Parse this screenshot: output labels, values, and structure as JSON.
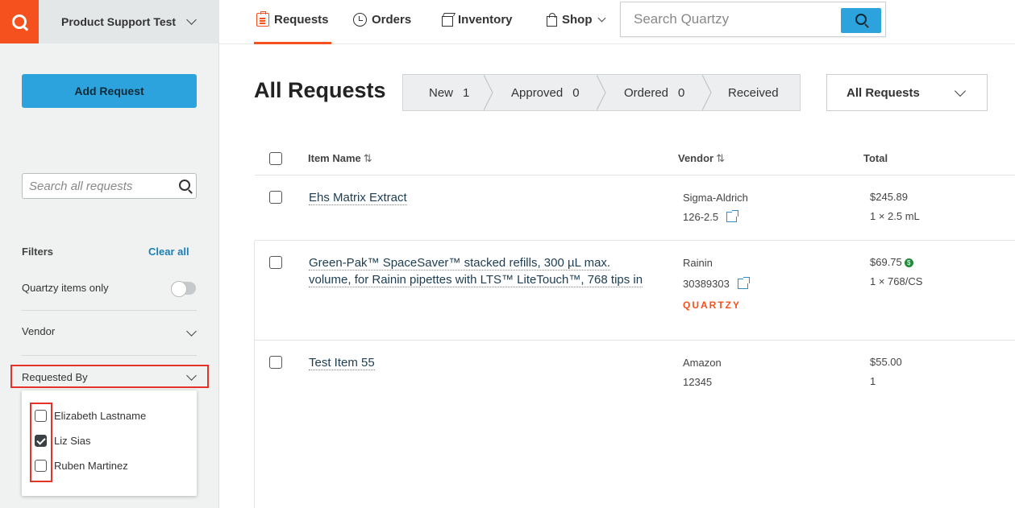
{
  "header": {
    "org_name": "Product Support Test",
    "nav": [
      {
        "label": "Requests",
        "icon": "clipboard-icon"
      },
      {
        "label": "Orders",
        "icon": "clock-icon"
      },
      {
        "label": "Inventory",
        "icon": "box-icon"
      },
      {
        "label": "Shop",
        "icon": "bag-icon"
      }
    ],
    "search_placeholder": "Search Quartzy"
  },
  "sidebar": {
    "add_request_label": "Add Request",
    "search_placeholder": "Search all requests",
    "filters_label": "Filters",
    "clear_all_label": "Clear all",
    "quartzy_only_label": "Quartzy items only",
    "vendor_label": "Vendor",
    "requested_by_label": "Requested By",
    "requested_by_options": [
      {
        "label": "Elizabeth Lastname",
        "checked": false
      },
      {
        "label": "Liz Sias",
        "checked": true
      },
      {
        "label": "Ruben Martinez",
        "checked": false
      }
    ]
  },
  "main": {
    "title": "All Requests",
    "steps": [
      {
        "label": "New",
        "count": "1"
      },
      {
        "label": "Approved",
        "count": "0"
      },
      {
        "label": "Ordered",
        "count": "0"
      },
      {
        "label": "Received",
        "count": ""
      }
    ],
    "view_select": "All Requests",
    "columns": {
      "item_name": "Item Name",
      "vendor": "Vendor",
      "total": "Total"
    },
    "sort_glyph": "⇅",
    "quartzy_brand": "QUARTZY",
    "rows": [
      {
        "name_line1": "Ehs Matrix Extract",
        "name_line2": "",
        "vendor": "Sigma-Aldrich",
        "catalog": "126-2.5",
        "price": "$245.89",
        "qty": "1 × 2.5 mL"
      },
      {
        "name_line1": "Green-Pak™ SpaceSaver™ stacked refills, 300 µL max.",
        "name_line2": "volume, for Rainin pipettes with LTS™ LiteTouch™, 768 tips in",
        "vendor": "Rainin",
        "catalog": "30389303",
        "price": "$69.75",
        "qty": "1 × 768/CS"
      },
      {
        "name_line1": "Test Item 55",
        "name_line2": "",
        "vendor": "Amazon",
        "catalog": "12345",
        "price": "$55.00",
        "qty": "1"
      }
    ]
  },
  "colors": {
    "brand": "#f4511e",
    "accent": "#2da3dd",
    "highlight": "#e5332a"
  }
}
